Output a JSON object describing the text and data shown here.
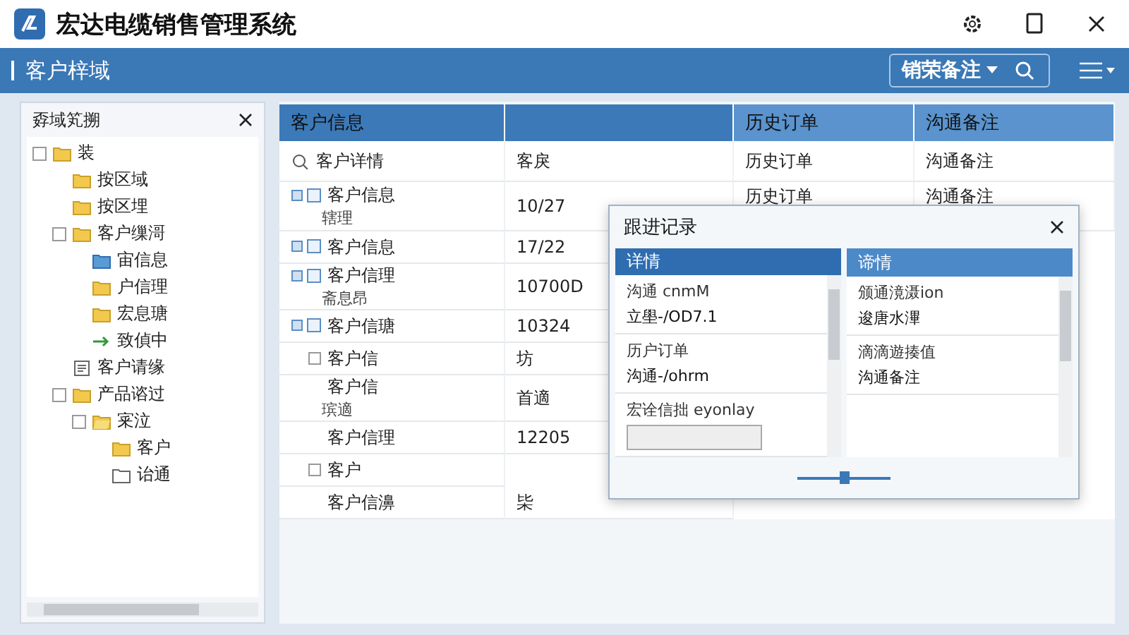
{
  "window": {
    "title": "宏达电缆销售管理系统"
  },
  "toolbar": {
    "title": "客户梓域",
    "dropdown": "销荣备注"
  },
  "sidebar": {
    "title": "孬域笂搠",
    "tree": [
      {
        "label": "装",
        "kind": "folder",
        "children": [
          {
            "label": "按区域",
            "kind": "folder"
          },
          {
            "label": "按区埋",
            "kind": "folder"
          },
          {
            "label": "客户缫滒",
            "kind": "folder",
            "children": [
              {
                "label": "宙信息",
                "kind": "folder-blue"
              },
              {
                "label": "户信理",
                "kind": "folder"
              },
              {
                "label": "宏息瑭",
                "kind": "folder"
              },
              {
                "label": "致偵中",
                "kind": "arrow"
              }
            ]
          },
          {
            "label": "客户请缘",
            "kind": "doc"
          },
          {
            "label": "产品谘过",
            "kind": "folder",
            "children": [
              {
                "label": "宷泣",
                "kind": "folder-open",
                "children": [
                  {
                    "label": "客户",
                    "kind": "folder"
                  },
                  {
                    "label": "诒通",
                    "kind": "folder-outline"
                  }
                ]
              }
            ]
          }
        ]
      }
    ]
  },
  "table": {
    "columns": [
      "客户信息",
      "",
      "历史订单",
      "沟通备注"
    ],
    "first_row": {
      "cells": [
        "客户详情",
        "客戾",
        "历史订单",
        "沟通备注"
      ]
    },
    "rows": [
      {
        "label": "客户信息",
        "sub": "辖理",
        "value": "10/27",
        "col3": "历史订单",
        "col4": "沟通备注",
        "kind": "node"
      },
      {
        "label": "客户信息",
        "value": "17/22",
        "kind": "node"
      },
      {
        "label": "客户信理",
        "sub": "斋息昂",
        "value": "10700D",
        "kind": "node"
      },
      {
        "label": "客户信瑭",
        "value": "10324",
        "kind": "node"
      },
      {
        "label": "客户信",
        "value": "坊",
        "kind": "leaf"
      },
      {
        "label": "客户信",
        "sub": "瑸適",
        "value": "首適",
        "kind": "plain"
      },
      {
        "label": "客户信理",
        "value": "12205",
        "kind": "plain"
      },
      {
        "label": "客户",
        "kind": "leaf"
      },
      {
        "label": "客户信濞",
        "value": "枈",
        "kind": "plain"
      }
    ]
  },
  "dialog": {
    "title": "跟进记录",
    "panes": [
      {
        "header": "详情",
        "selected": true,
        "items": [
          {
            "line1": "沟通 cnmM",
            "line2": "立壆-/OD7.1"
          },
          {
            "line1": "历户订单",
            "line2": "沟通-/ohrm"
          },
          {
            "line1": "宏诠信拙 eyonlay",
            "field": true
          }
        ]
      },
      {
        "header": "谛情",
        "selected": false,
        "items": [
          {
            "line1": "颁通滰滠ion",
            "line2": "逡唐水滭"
          },
          {
            "line1": "滴滴遊揍值",
            "line2": "沟通备注"
          }
        ]
      }
    ],
    "slider": {
      "level": 0.5
    }
  }
}
